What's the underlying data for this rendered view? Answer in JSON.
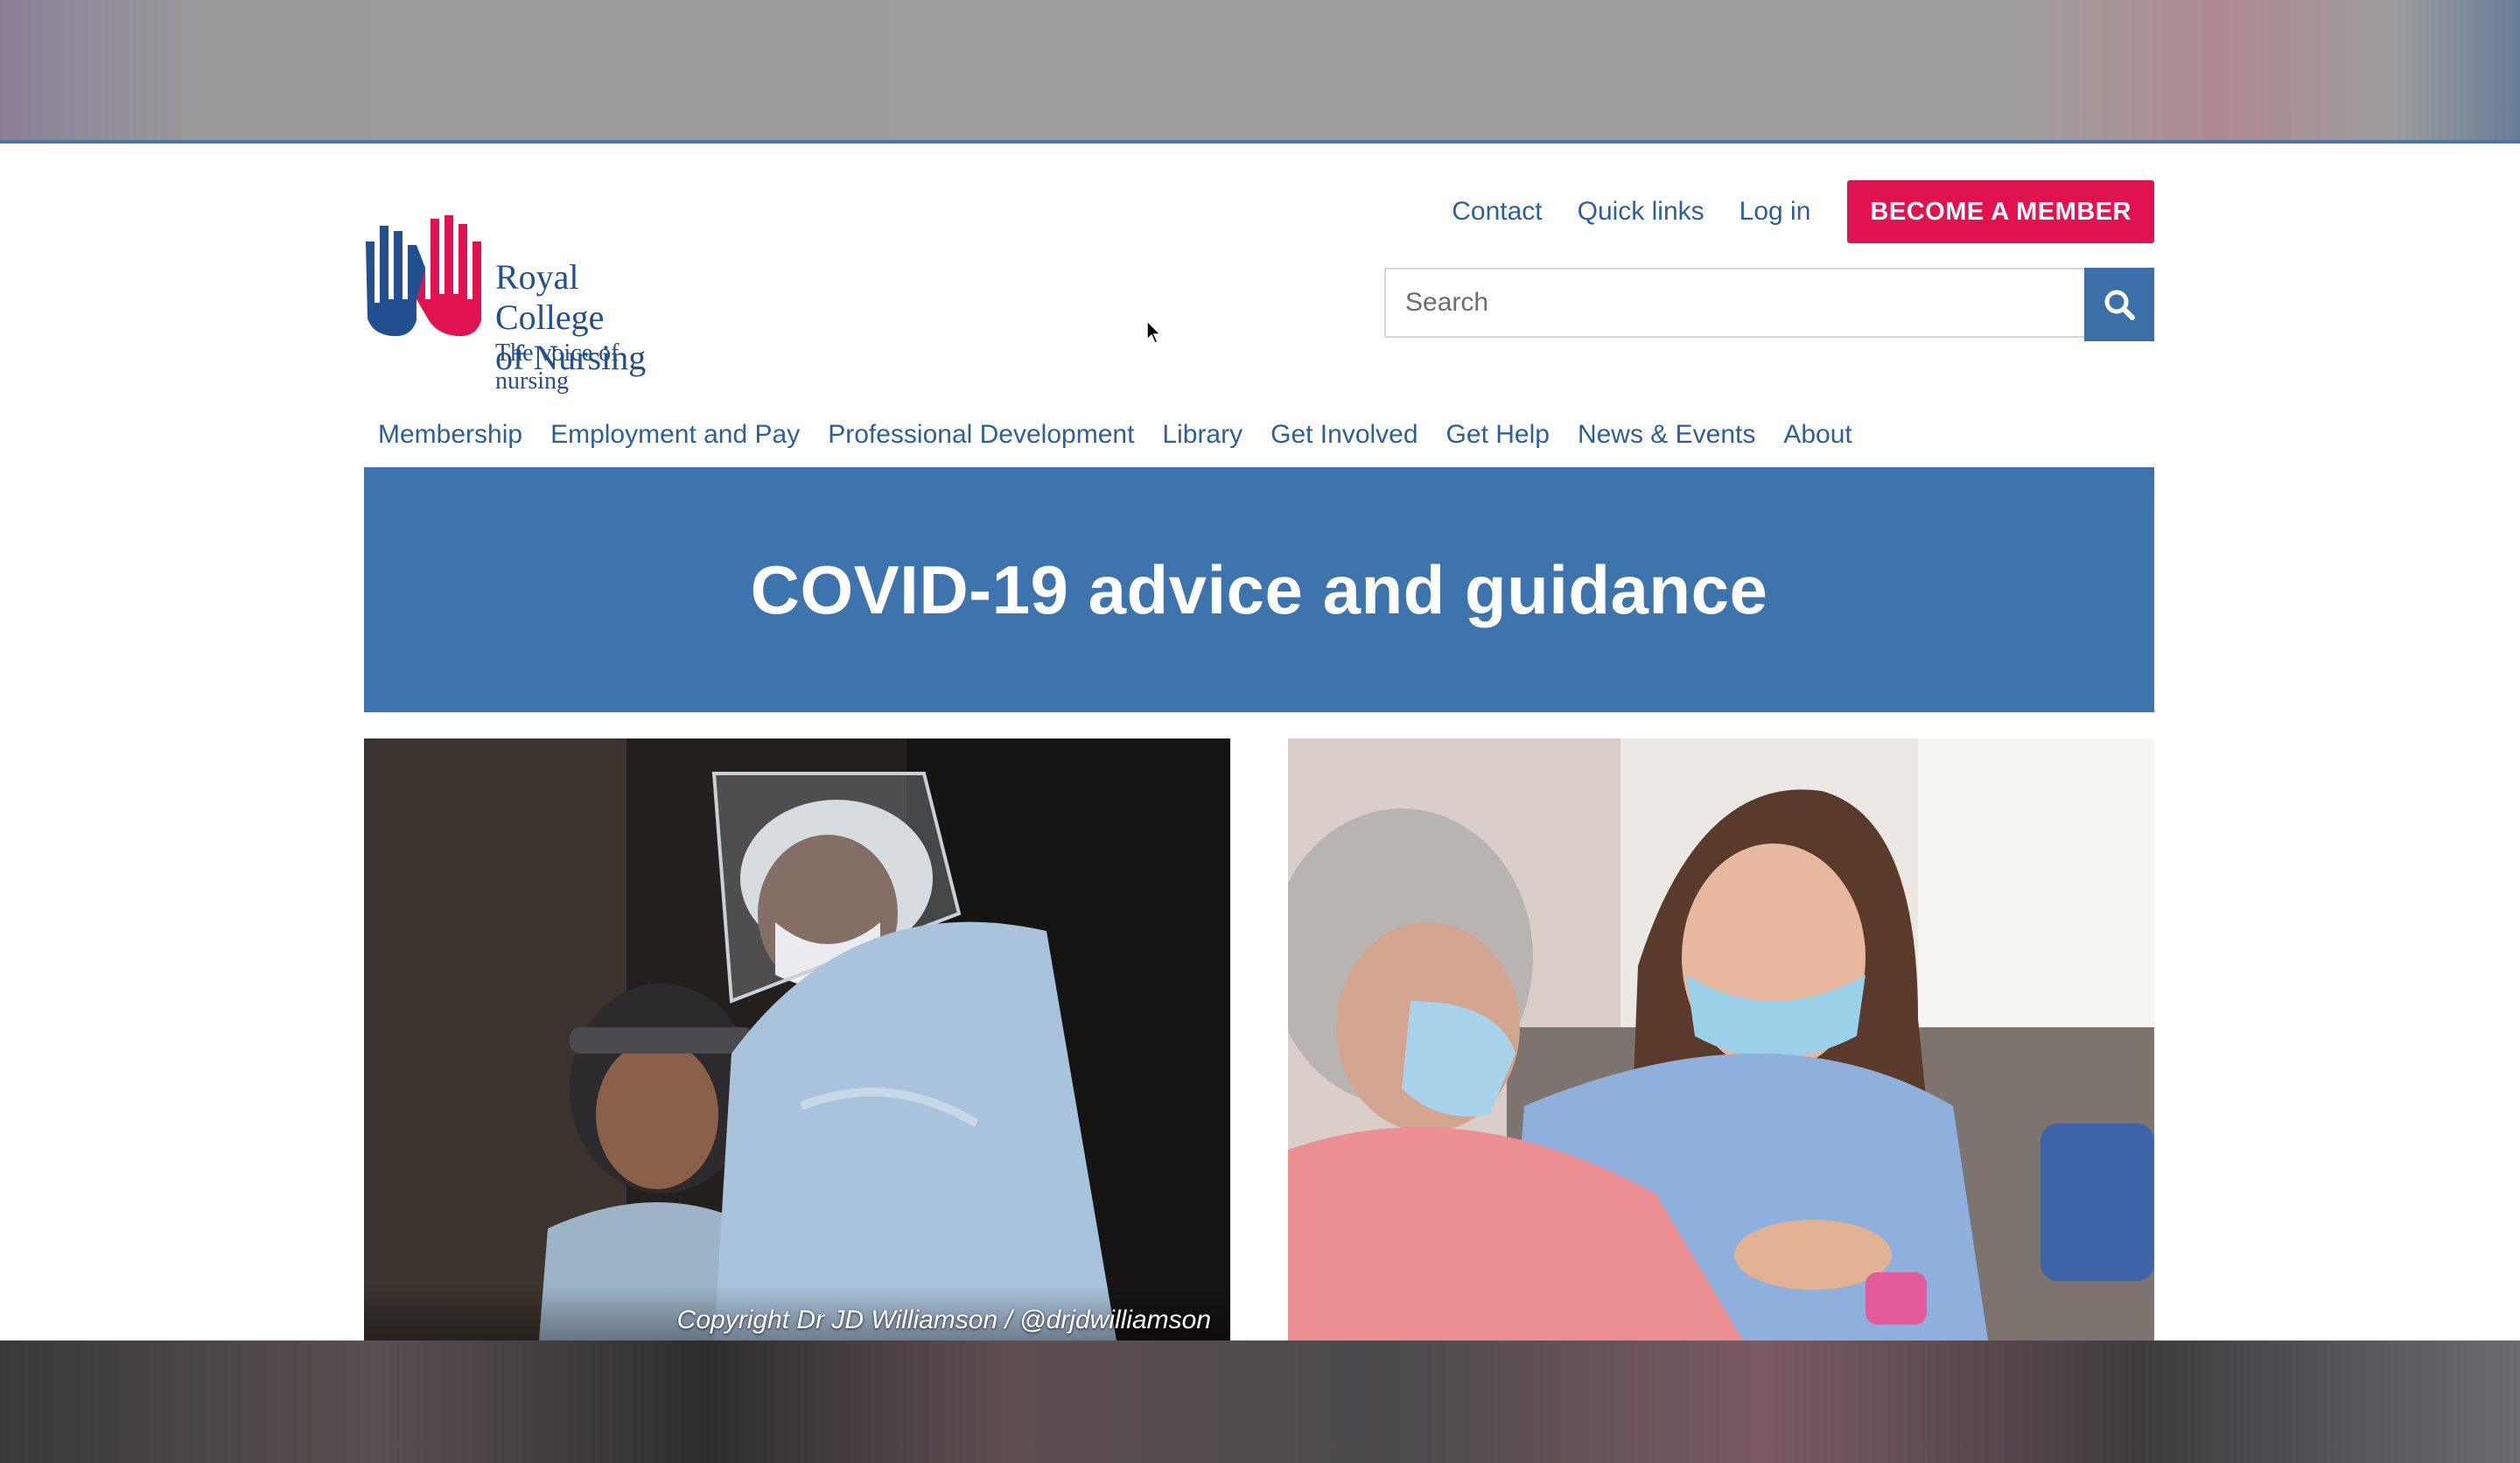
{
  "brand": {
    "name_line1": "Royal College",
    "name_line2": "of Nursing",
    "tagline": "The voice of nursing",
    "colors": {
      "primary": "#214f8f",
      "accent": "#e0124f",
      "hero": "#3d74ad"
    }
  },
  "utility_nav": {
    "contact": "Contact",
    "quick_links": "Quick links",
    "log_in": "Log in",
    "become_member": "BECOME A MEMBER"
  },
  "search": {
    "placeholder": "Search",
    "icon": "search-icon"
  },
  "main_nav": [
    {
      "label": "Membership"
    },
    {
      "label": "Employment and Pay"
    },
    {
      "label": "Professional Development"
    },
    {
      "label": "Library"
    },
    {
      "label": "Get Involved"
    },
    {
      "label": "Get Help"
    },
    {
      "label": "News & Events"
    },
    {
      "label": "About"
    }
  ],
  "hero": {
    "title": "COVID-19 advice and guidance"
  },
  "cards": [
    {
      "image": "healthcare-workers-in-ppe-photo",
      "caption": "Copyright Dr JD Williamson / @drjdwilliamson"
    },
    {
      "image": "masked-nurse-with-patient-photo",
      "caption": ""
    }
  ]
}
